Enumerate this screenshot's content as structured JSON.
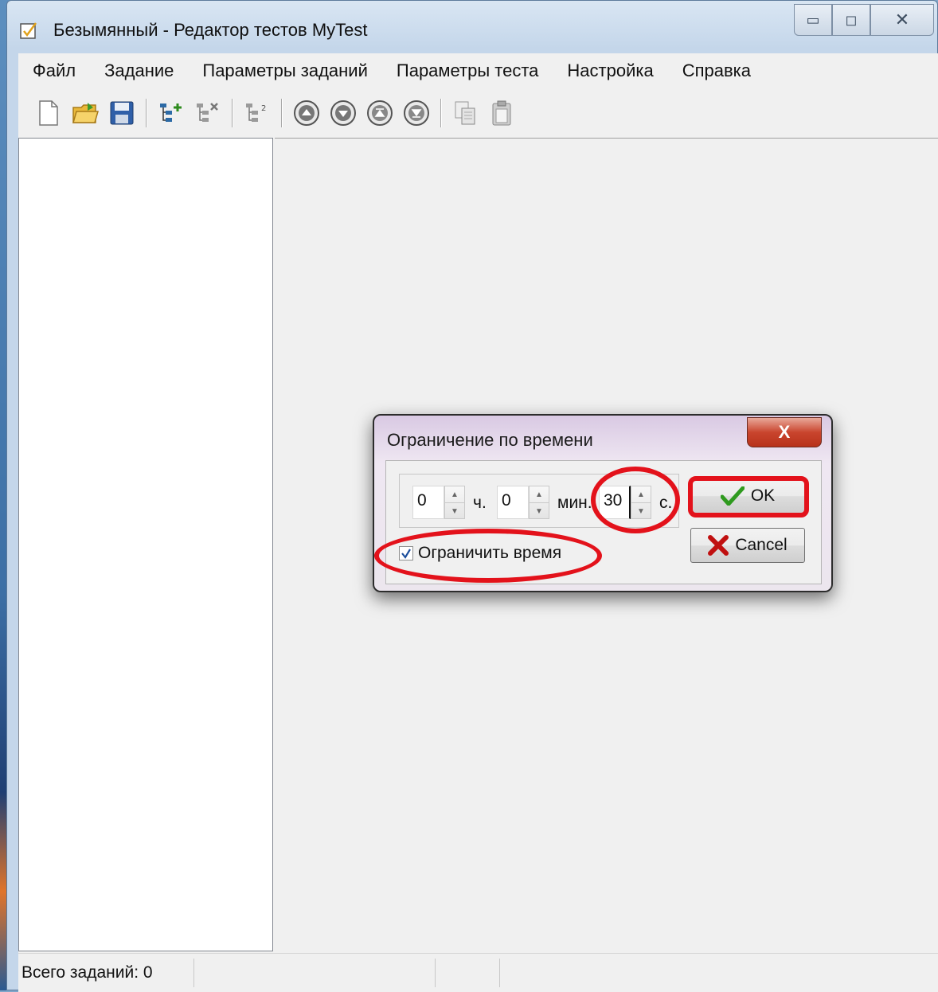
{
  "window": {
    "title": "Безымянный - Редактор тестов MyTest",
    "min_glyph": "▭",
    "max_glyph": "◻",
    "close_glyph": "✕"
  },
  "menu": {
    "items": [
      {
        "label": "Файл"
      },
      {
        "label": "Задание"
      },
      {
        "label": "Параметры заданий"
      },
      {
        "label": "Параметры теста"
      },
      {
        "label": "Настройка"
      },
      {
        "label": "Справка"
      }
    ]
  },
  "toolbar": {
    "icons": [
      "new-file-icon",
      "open-folder-icon",
      "save-icon",
      "add-task-icon",
      "delete-task-icon",
      "task-settings-icon",
      "move-up-icon",
      "move-down-icon",
      "move-top-icon",
      "move-bottom-icon",
      "copy-icon",
      "paste-icon"
    ]
  },
  "status": {
    "total_tasks": "Всего заданий: 0"
  },
  "dialog": {
    "title": "Ограничение по времени",
    "close_glyph": "X",
    "hours_value": "0",
    "hours_unit": "ч.",
    "minutes_value": "0",
    "minutes_unit": "мин.",
    "seconds_value": "30",
    "seconds_unit": "с.",
    "limit_time_label": "Ограничить время",
    "limit_time_checked": true,
    "ok_label": "OK",
    "cancel_label": "Cancel",
    "spin_up": "▲",
    "spin_down": "▼"
  },
  "colors": {
    "annotation": "#e3121b",
    "ok_check": "#2f9a1f",
    "cancel_x": "#c01010"
  }
}
